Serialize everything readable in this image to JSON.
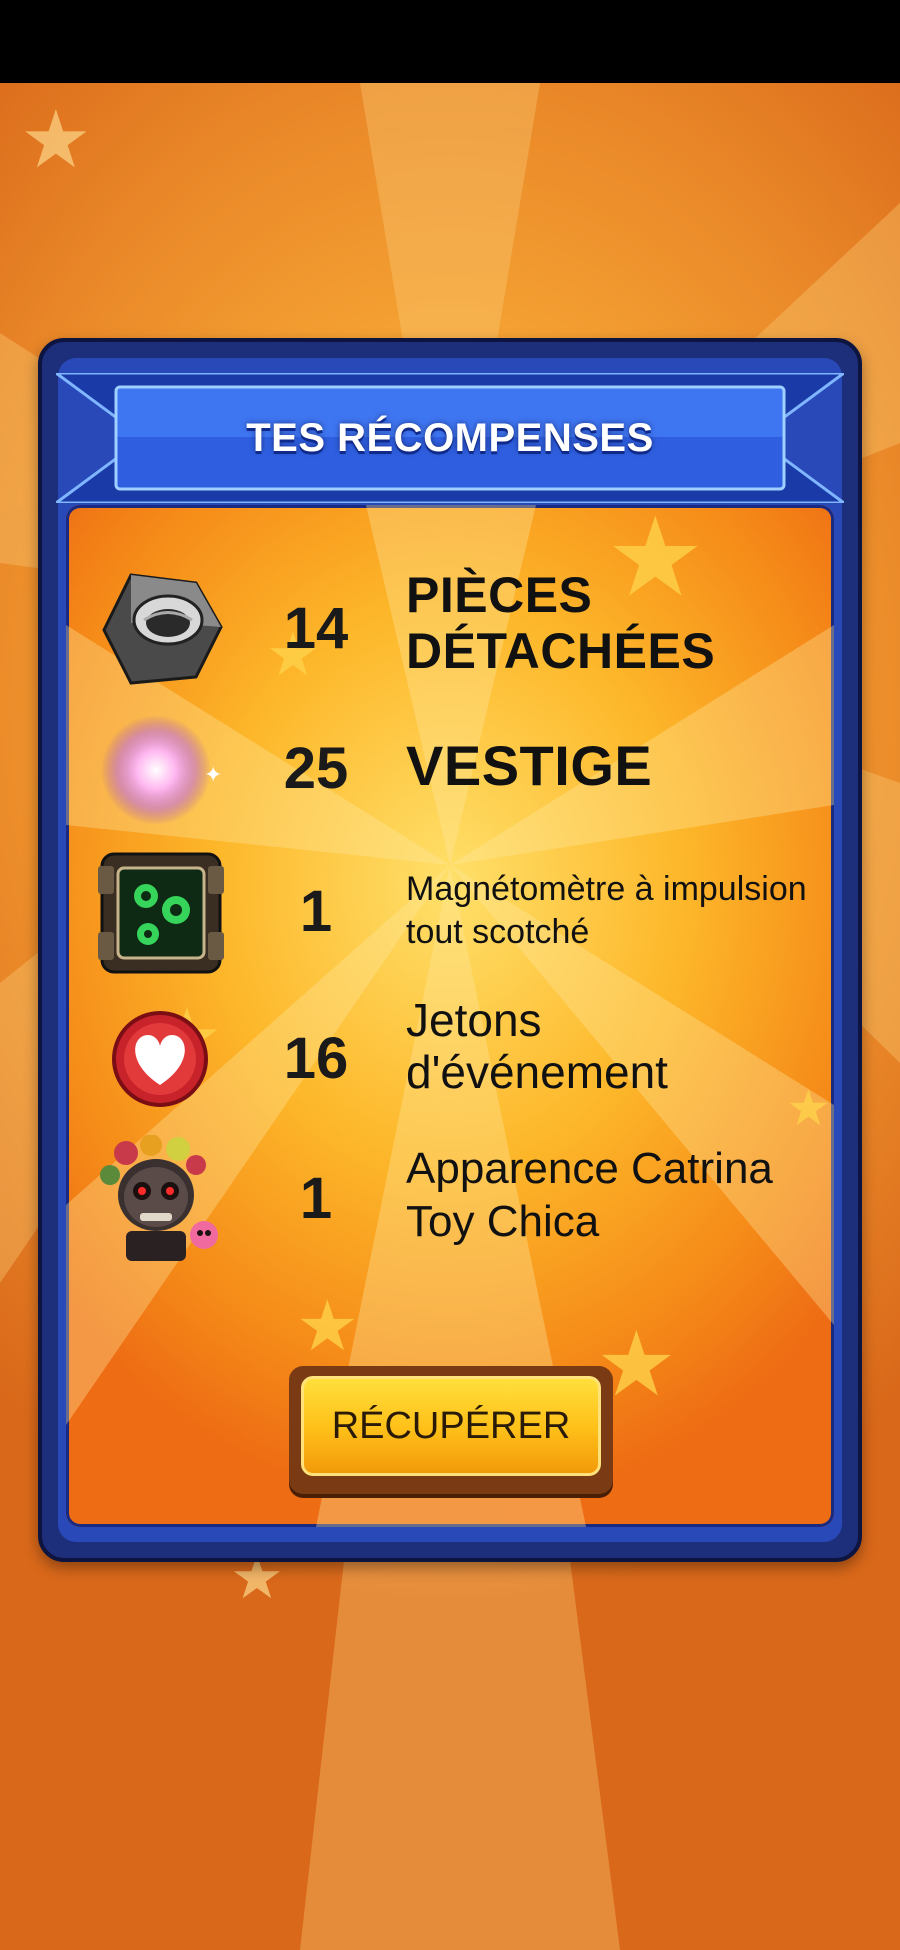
{
  "header": {
    "title": "TES RÉCOMPENSES"
  },
  "rewards": [
    {
      "qty": "14",
      "name": "PIÈCES DÉTACHÉES",
      "icon": "hex-nut-icon"
    },
    {
      "qty": "25",
      "name": "VESTIGE",
      "icon": "glowing-orb-icon"
    },
    {
      "qty": "1",
      "name": "Magnétomètre à impulsion tout scotché",
      "icon": "magnetometer-icon"
    },
    {
      "qty": "16",
      "name": "Jetons d'événement",
      "icon": "heart-token-icon"
    },
    {
      "qty": "1",
      "name": "Apparence Catrina Toy Chica",
      "icon": "catrina-skin-icon"
    }
  ],
  "claim_label": "RÉCUPÉRER",
  "colors": {
    "panel_frame": "#1d2e7a",
    "ribbon_blue": "#2f5fe0",
    "button_gold": "#ffc21a",
    "background_orange": "#f5a233"
  }
}
